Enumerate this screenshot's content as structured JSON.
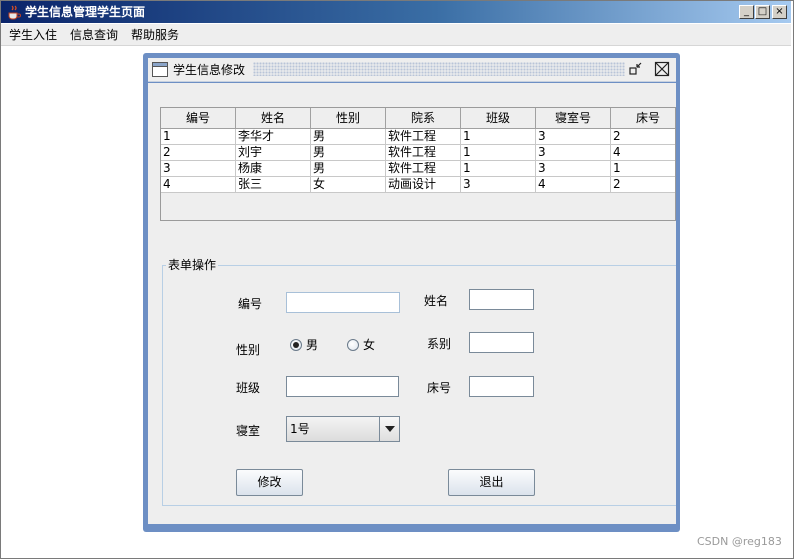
{
  "window": {
    "title": "学生信息管理学生页面",
    "controls": {
      "minimize": "_",
      "maximize": "□",
      "close": "×"
    }
  },
  "menubar": {
    "items": [
      "学生入住",
      "信息查询",
      "帮助服务"
    ]
  },
  "internal_frame": {
    "title": "学生信息修改",
    "table": {
      "columns": [
        "编号",
        "姓名",
        "性别",
        "院系",
        "班级",
        "寝室号",
        "床号"
      ],
      "rows": [
        [
          "1",
          "李华才",
          "男",
          "软件工程",
          "1",
          "3",
          "2"
        ],
        [
          "2",
          "刘宇",
          "男",
          "软件工程",
          "1",
          "3",
          "4"
        ],
        [
          "3",
          "杨康",
          "男",
          "软件工程",
          "1",
          "3",
          "1"
        ],
        [
          "4",
          "张三",
          "女",
          "动画设计",
          "3",
          "4",
          "2"
        ]
      ]
    },
    "form": {
      "legend": "表单操作",
      "id_label": "编号",
      "id_value": "",
      "name_label": "姓名",
      "name_value": "",
      "gender_label": "性别",
      "gender_options": [
        "男",
        "女"
      ],
      "gender_selected": "男",
      "dept_label": "系别",
      "dept_value": "",
      "class_label": "班级",
      "class_value": "",
      "bed_label": "床号",
      "bed_value": "",
      "dorm_label": "寝室",
      "dorm_selected": "1号",
      "modify_button": "修改",
      "exit_button": "退出"
    }
  },
  "watermark": "CSDN @reg183",
  "colors": {
    "titlebar_start": "#0a246a",
    "titlebar_end": "#a6caf0",
    "frame_border": "#6d8fc4",
    "panel_bg": "#eeeeee"
  }
}
